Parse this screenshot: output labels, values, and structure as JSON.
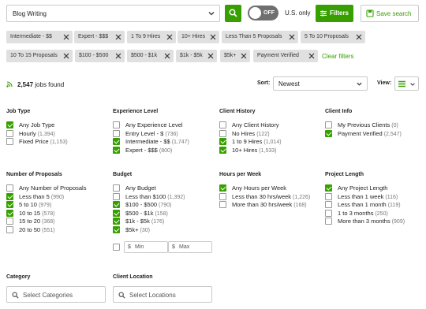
{
  "search": {
    "value": "Blog Writing"
  },
  "toggle": {
    "label": "OFF"
  },
  "us_only_label": "U.S. only",
  "filters_button": "Filters",
  "save_search": "Save search",
  "chips": [
    "Intermediate - $$",
    "Expert - $$$",
    "1 To 9 Hires",
    "10+ Hires",
    "Less Than 5 Proposals",
    "5 To 10 Proposals",
    "10 To 15 Proposals",
    "$100 - $500",
    "$500 - $1k",
    "$1k - $5k",
    "$5k+",
    "Payment Verified"
  ],
  "clear_filters": "Clear filters",
  "results": {
    "count": "2,547",
    "suffix": "jobs found"
  },
  "sort": {
    "label": "Sort:",
    "value": "Newest"
  },
  "view": {
    "label": "View:"
  },
  "groups": {
    "job_type": {
      "title": "Job Type",
      "options": [
        {
          "label": "Any Job Type",
          "count": "",
          "checked": true
        },
        {
          "label": "Hourly",
          "count": "(1,394)",
          "checked": false
        },
        {
          "label": "Fixed Price",
          "count": "(1,153)",
          "checked": false
        }
      ]
    },
    "experience": {
      "title": "Experience Level",
      "options": [
        {
          "label": "Any Experience Level",
          "count": "",
          "checked": false
        },
        {
          "label": "Entry Level - $",
          "count": "(736)",
          "checked": false
        },
        {
          "label": "Intermediate - $$",
          "count": "(1,747)",
          "checked": true
        },
        {
          "label": "Expert - $$$",
          "count": "(800)",
          "checked": true
        }
      ]
    },
    "client_history": {
      "title": "Client History",
      "options": [
        {
          "label": "Any Client History",
          "count": "",
          "checked": false
        },
        {
          "label": "No Hires",
          "count": "(122)",
          "checked": false
        },
        {
          "label": "1 to 9 Hires",
          "count": "(1,014)",
          "checked": true
        },
        {
          "label": "10+ Hires",
          "count": "(1,533)",
          "checked": true
        }
      ]
    },
    "client_info": {
      "title": "Client Info",
      "options": [
        {
          "label": "My Previous Clients",
          "count": "(0)",
          "checked": false
        },
        {
          "label": "Payment Verified",
          "count": "(2,547)",
          "checked": true
        }
      ]
    },
    "proposals": {
      "title": "Number of Proposals",
      "options": [
        {
          "label": "Any Number of Proposals",
          "count": "",
          "checked": false
        },
        {
          "label": "Less than 5",
          "count": "(990)",
          "checked": true
        },
        {
          "label": "5 to 10",
          "count": "(979)",
          "checked": true
        },
        {
          "label": "10 to 15",
          "count": "(578)",
          "checked": true
        },
        {
          "label": "15 to 20",
          "count": "(368)",
          "checked": false
        },
        {
          "label": "20 to 50",
          "count": "(551)",
          "checked": false
        }
      ]
    },
    "budget": {
      "title": "Budget",
      "options": [
        {
          "label": "Any Budget",
          "count": "",
          "checked": false
        },
        {
          "label": "Less than $100",
          "count": "(1,392)",
          "checked": false
        },
        {
          "label": "$100 - $500",
          "count": "(790)",
          "checked": true
        },
        {
          "label": "$500 - $1k",
          "count": "(158)",
          "checked": true
        },
        {
          "label": "$1k - $5k",
          "count": "(176)",
          "checked": true
        },
        {
          "label": "$5k+",
          "count": "(30)",
          "checked": true
        }
      ],
      "currency": "$",
      "min_placeholder": "Min",
      "max_placeholder": "Max"
    },
    "hours": {
      "title": "Hours per Week",
      "options": [
        {
          "label": "Any Hours per Week",
          "count": "",
          "checked": true
        },
        {
          "label": "Less than 30 hrs/week",
          "count": "(1,226)",
          "checked": false
        },
        {
          "label": "More than 30 hrs/week",
          "count": "(168)",
          "checked": false
        }
      ]
    },
    "project_length": {
      "title": "Project Length",
      "options": [
        {
          "label": "Any Project Length",
          "count": "",
          "checked": true
        },
        {
          "label": "Less than 1 week",
          "count": "(116)",
          "checked": false
        },
        {
          "label": "Less than 1 month",
          "count": "(119)",
          "checked": false
        },
        {
          "label": "1 to 3 months",
          "count": "(250)",
          "checked": false
        },
        {
          "label": "More than 3 months",
          "count": "(909)",
          "checked": false
        }
      ]
    },
    "category": {
      "title": "Category",
      "placeholder": "Select Categories"
    },
    "client_location": {
      "title": "Client Location",
      "placeholder": "Select Locations"
    }
  },
  "colors": {
    "accent": "#37a000",
    "chip_bg": "#e0e0e0",
    "toggle_off": "#6f6f6f"
  }
}
